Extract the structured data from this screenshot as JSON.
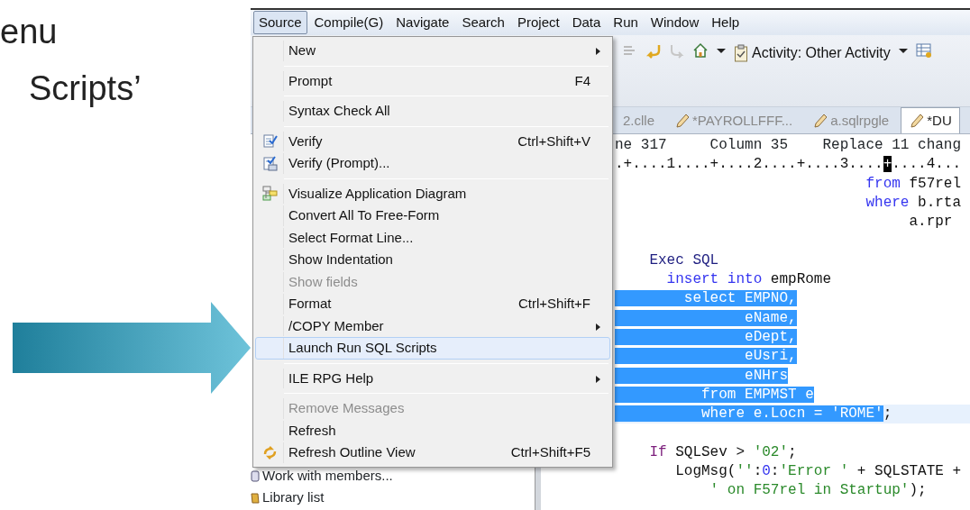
{
  "slide": {
    "lines": [
      "enu",
      "Scripts’"
    ]
  },
  "menubar": [
    {
      "label": "Source",
      "selected": true
    },
    {
      "label": "Compile(G)",
      "selected": false
    },
    {
      "label": "Navigate",
      "selected": false
    },
    {
      "label": "Search",
      "selected": false
    },
    {
      "label": "Project",
      "selected": false
    },
    {
      "label": "Data",
      "selected": false
    },
    {
      "label": "Run",
      "selected": false
    },
    {
      "label": "Window",
      "selected": false
    },
    {
      "label": "Help",
      "selected": false
    }
  ],
  "toolbar": {
    "activity": "Activity: Other Activity"
  },
  "editor_tabs": [
    {
      "label": "2.clle",
      "edit_icon": false,
      "selected": false
    },
    {
      "label": "*PAYROLLFFF...",
      "edit_icon": true,
      "selected": false
    },
    {
      "label": "a.sqlrpgle",
      "edit_icon": true,
      "selected": false
    },
    {
      "label": "*DU",
      "edit_icon": true,
      "selected": true
    }
  ],
  "side_panel": {
    "items": [
      {
        "label": "Work with members..."
      },
      {
        "label": "Library list"
      }
    ]
  },
  "editor": {
    "status": "ne 317     Column 35    Replace 11 chang",
    "lines": [
      {
        "kind": "code",
        "current": false,
        "segments": [
          {
            "text": ".+....1....+....2....+....3....",
            "kind": "plain",
            "selected": false
          },
          {
            "text": "+",
            "kind": "cursor",
            "selected": false
          },
          {
            "text": "....4...",
            "kind": "plain",
            "selected": false
          }
        ]
      },
      {
        "kind": "code",
        "current": false,
        "segments": [
          {
            "text": "                             from",
            "kind": "keyword",
            "selected": false
          },
          {
            "text": " f57rel",
            "kind": "plain",
            "selected": false
          }
        ]
      },
      {
        "kind": "code",
        "current": false,
        "segments": [
          {
            "text": "                             where",
            "kind": "keyword",
            "selected": false
          },
          {
            "text": " b.rta",
            "kind": "plain",
            "selected": false
          }
        ]
      },
      {
        "kind": "code",
        "current": false,
        "segments": [
          {
            "text": "                                  a.rpr",
            "kind": "plain",
            "selected": false
          }
        ]
      },
      {
        "kind": "blank"
      },
      {
        "kind": "code",
        "current": false,
        "segments": [
          {
            "text": "    Exec SQL",
            "kind": "exec",
            "selected": false
          }
        ]
      },
      {
        "kind": "code",
        "current": false,
        "segments": [
          {
            "text": "      insert into",
            "kind": "keyword",
            "selected": false
          },
          {
            "text": " empRome",
            "kind": "plain",
            "selected": false
          }
        ]
      },
      {
        "kind": "code",
        "current": false,
        "segments": [
          {
            "text": "        select EMPNO,",
            "kind": "keyword",
            "selected": true
          }
        ]
      },
      {
        "kind": "code",
        "current": false,
        "segments": [
          {
            "text": "               eName,",
            "kind": "plain",
            "selected": true
          }
        ]
      },
      {
        "kind": "code",
        "current": false,
        "segments": [
          {
            "text": "               eDept,",
            "kind": "plain",
            "selected": true
          }
        ]
      },
      {
        "kind": "code",
        "current": false,
        "segments": [
          {
            "text": "               eUsri,",
            "kind": "plain",
            "selected": true
          }
        ]
      },
      {
        "kind": "code",
        "current": false,
        "segments": [
          {
            "text": "               eNHrs",
            "kind": "plain",
            "selected": true
          }
        ]
      },
      {
        "kind": "code",
        "current": false,
        "segments": [
          {
            "text": "          from EMPMST e",
            "kind": "keyword",
            "selected": true
          }
        ]
      },
      {
        "kind": "code",
        "current": true,
        "segments": [
          {
            "text": "          where e.Locn = 'ROME'",
            "kind": "keyword",
            "selected": true
          },
          {
            "text": ";",
            "kind": "plain",
            "selected": false
          }
        ]
      },
      {
        "kind": "blank"
      },
      {
        "kind": "code",
        "current": false,
        "segments": [
          {
            "text": "    If",
            "kind": "control",
            "selected": false
          },
          {
            "text": " SQLSev > ",
            "kind": "plain",
            "selected": false
          },
          {
            "text": "'02'",
            "kind": "string",
            "selected": false
          },
          {
            "text": ";",
            "kind": "plain",
            "selected": false
          }
        ]
      },
      {
        "kind": "code",
        "current": false,
        "segments": [
          {
            "text": "       LogMsg(",
            "kind": "plain",
            "selected": false
          },
          {
            "text": "''",
            "kind": "string",
            "selected": false
          },
          {
            "text": ":",
            "kind": "plain",
            "selected": false
          },
          {
            "text": "0",
            "kind": "number",
            "selected": false
          },
          {
            "text": ":",
            "kind": "plain",
            "selected": false
          },
          {
            "text": "'Error '",
            "kind": "string",
            "selected": false
          },
          {
            "text": " + SQLSTATE +",
            "kind": "plain",
            "selected": false
          }
        ]
      },
      {
        "kind": "code",
        "current": false,
        "segments": [
          {
            "text": "           ' on F57rel in Startup'",
            "kind": "string",
            "selected": false
          },
          {
            "text": ");",
            "kind": "plain",
            "selected": false
          }
        ]
      }
    ]
  },
  "menu": {
    "items": [
      {
        "kind": "item",
        "label": "New",
        "submenu": true,
        "disabled": false,
        "selected": false
      },
      {
        "kind": "separator"
      },
      {
        "kind": "item",
        "label": "Prompt",
        "shortcut": "F4",
        "submenu": false,
        "disabled": false,
        "selected": false
      },
      {
        "kind": "separator"
      },
      {
        "kind": "item",
        "label": "Syntax Check All",
        "submenu": false,
        "disabled": false,
        "selected": false
      },
      {
        "kind": "separator"
      },
      {
        "kind": "item",
        "label": "Verify",
        "shortcut": "Ctrl+Shift+V",
        "submenu": false,
        "disabled": false,
        "selected": false
      },
      {
        "kind": "item",
        "label": "Verify (Prompt)...",
        "submenu": false,
        "disabled": false,
        "selected": false
      },
      {
        "kind": "separator"
      },
      {
        "kind": "item",
        "label": "Visualize Application Diagram",
        "submenu": false,
        "disabled": false,
        "selected": false
      },
      {
        "kind": "item",
        "label": "Convert All To Free-Form",
        "submenu": false,
        "disabled": false,
        "selected": false
      },
      {
        "kind": "item",
        "label": "Select Format Line...",
        "submenu": false,
        "disabled": false,
        "selected": false
      },
      {
        "kind": "item",
        "label": "Show Indentation",
        "submenu": false,
        "disabled": false,
        "selected": false
      },
      {
        "kind": "item",
        "label": "Show fields",
        "submenu": false,
        "disabled": true,
        "selected": false
      },
      {
        "kind": "item",
        "label": "Format",
        "shortcut": "Ctrl+Shift+F",
        "submenu": false,
        "disabled": false,
        "selected": false
      },
      {
        "kind": "item",
        "label": "/COPY Member",
        "submenu": true,
        "disabled": false,
        "selected": false
      },
      {
        "kind": "item",
        "label": "Launch Run SQL Scripts",
        "submenu": false,
        "disabled": false,
        "selected": true
      },
      {
        "kind": "separator"
      },
      {
        "kind": "item",
        "label": "ILE RPG Help",
        "submenu": true,
        "disabled": false,
        "selected": false
      },
      {
        "kind": "separator"
      },
      {
        "kind": "item",
        "label": "Remove Messages",
        "submenu": false,
        "disabled": true,
        "selected": false
      },
      {
        "kind": "item",
        "label": "Refresh",
        "submenu": false,
        "disabled": false,
        "selected": false
      },
      {
        "kind": "item",
        "label": "Refresh Outline View",
        "shortcut": "Ctrl+Shift+F5",
        "submenu": false,
        "disabled": false,
        "selected": false
      }
    ]
  }
}
